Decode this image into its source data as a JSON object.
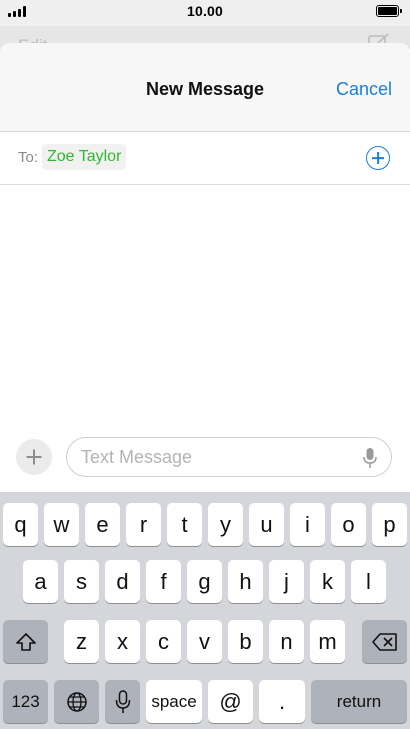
{
  "status_bar": {
    "time": "10.00"
  },
  "background": {
    "edit_label": "Edit"
  },
  "header": {
    "title": "New Message",
    "cancel_label": "Cancel"
  },
  "recipients": {
    "to_label": "To:",
    "chips": [
      "Zoe Taylor"
    ]
  },
  "composer": {
    "placeholder": "Text Message"
  },
  "keyboard": {
    "row1": [
      "q",
      "w",
      "e",
      "r",
      "t",
      "y",
      "u",
      "i",
      "o",
      "p"
    ],
    "row2": [
      "a",
      "s",
      "d",
      "f",
      "g",
      "h",
      "j",
      "k",
      "l"
    ],
    "row3": [
      "z",
      "x",
      "c",
      "v",
      "b",
      "n",
      "m"
    ],
    "numbers_label": "123",
    "space_label": "space",
    "at_label": "@",
    "period_label": ".",
    "return_label": "return",
    "icons": [
      "shift-icon",
      "delete-icon",
      "globe-icon",
      "dictation-icon"
    ]
  },
  "colors": {
    "accent": "#1a7fd4",
    "recipient": "#2eb82e",
    "keyboard_bg": "#d4d6db"
  }
}
